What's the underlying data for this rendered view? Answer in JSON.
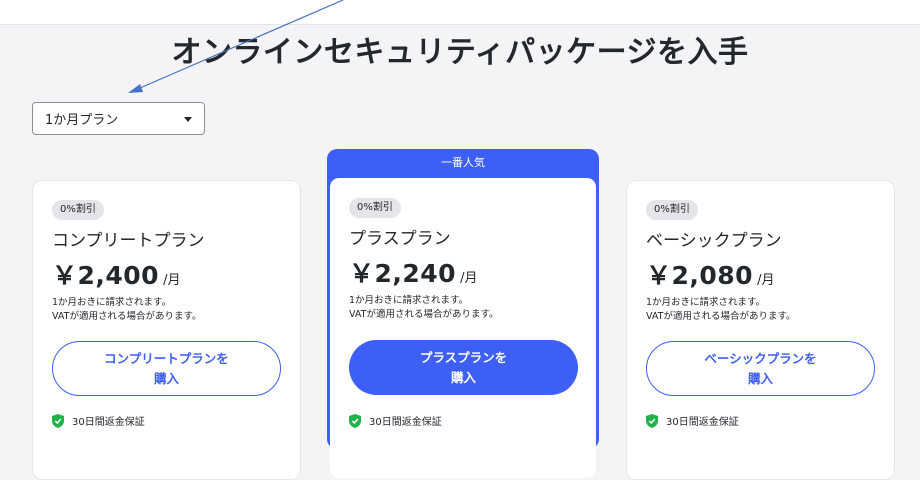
{
  "page": {
    "title": "オンラインセキュリティパッケージを入手"
  },
  "plan_select": {
    "selected": "1か月プラン"
  },
  "popular_label": "一番人気",
  "plans": [
    {
      "discount": "0%割引",
      "name": "コンプリートプラン",
      "price": "￥2,400",
      "per": "/月",
      "billing": "1か月おきに請求されます。",
      "vat": "VATが適用される場合があります。",
      "button": "コンプリートプランを\n購入",
      "guarantee": "30日間返金保証"
    },
    {
      "discount": "0%割引",
      "name": "プラスプラン",
      "price": "￥2,240",
      "per": "/月",
      "billing": "1か月おきに請求されます。",
      "vat": "VATが適用される場合があります。",
      "button": "プラスプランを\n購入",
      "guarantee": "30日間返金保証"
    },
    {
      "discount": "0%割引",
      "name": "ベーシックプラン",
      "price": "￥2,080",
      "per": "/月",
      "billing": "1か月おきに請求されます。",
      "vat": "VATが適用される場合があります。",
      "button": "ベーシックプランを\n購入",
      "guarantee": "30日間返金保証"
    }
  ],
  "colors": {
    "accent": "#3e5ff5",
    "guarantee_green": "#22b24c",
    "annotation_arrow": "#4472c4"
  },
  "icons": {
    "dropdown": "chevron-down-icon",
    "guarantee": "shield-check-icon",
    "annotation": "annotation-arrow"
  }
}
